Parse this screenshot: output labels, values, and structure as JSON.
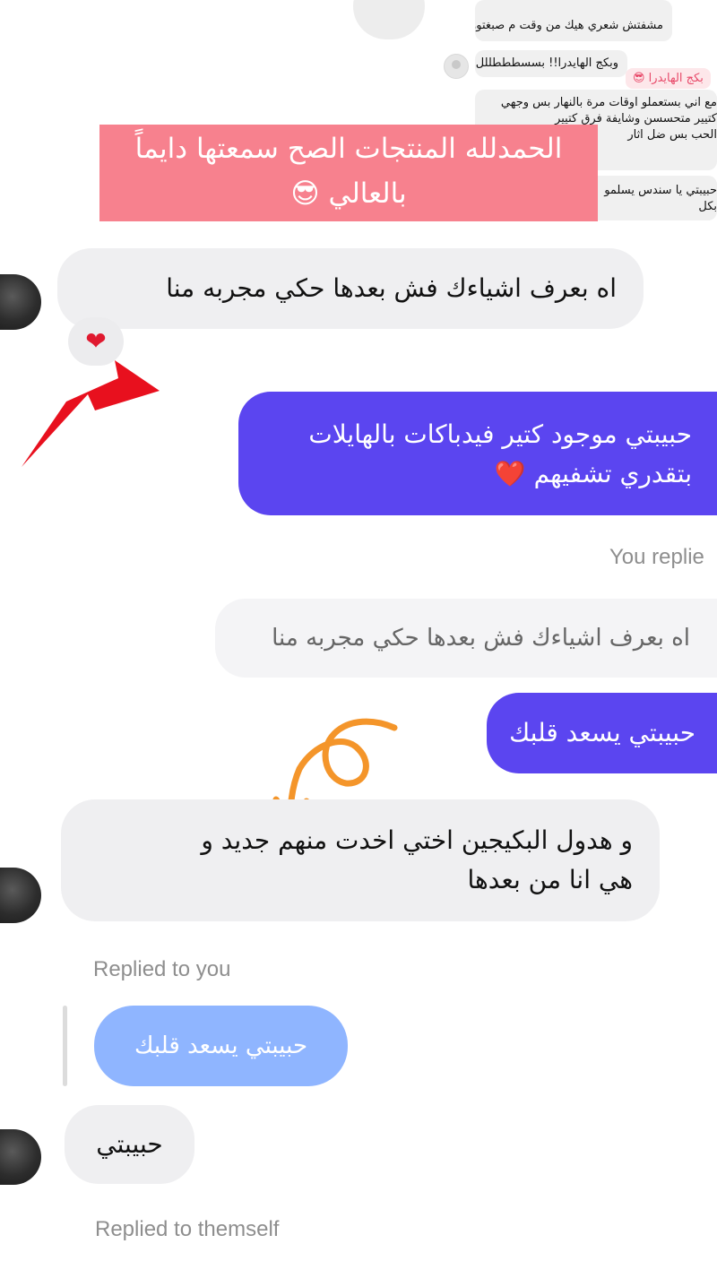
{
  "screenshot": {
    "line1": "مشفتش شعري هيك من وقت م صبغتوو",
    "line2": "وبكج الهايدرا!! بسسطططللل",
    "pink_label": "بكج الهايدرا 😎",
    "line3a": "مع اني بستعملو اوقات مرة بالنهار بس وجهي",
    "line3b": "كتيير متحسسن وشايفة فرق كتيير",
    "line3c": "الحب بس ضل اثار",
    "line4a": "حبيبتي يا سندس يسلمو",
    "line4b": "بكل"
  },
  "banner": {
    "line1": "الحمدلله المنتجات الصح سمعتها دايماً",
    "line2": "بالعالي 😎"
  },
  "messages": {
    "m1": "اه بعرف اشياءك فش بعدها حكي مجربه منا",
    "m1_reaction": "❤",
    "m2_line1": "حبيبتي موجود كتير فيدباكات بالهايلات",
    "m2_line2": "بتقدري تشفيهم",
    "m2_emoji": "❤️",
    "reply_meta_1": "You replie",
    "quote_1": "اه بعرف اشياءك فش بعدها حكي مجربه منا",
    "m3": "حبيبتي يسعد قلبك",
    "m4_line1": "و هدول البكيجين اختي اخدت منهم جديد و",
    "m4_line2": "هي انا من بعدها",
    "reply_meta_2": "Replied to you",
    "quote_2": "حبيبتي يسعد قلبك",
    "m5": "حبيبتي",
    "reply_meta_3": "Replied to themself"
  },
  "colors": {
    "outgoing": "#5b45f0",
    "incoming": "#efeff1",
    "banner": "#f7818e",
    "arrow_red": "#e8101e",
    "arrow_orange": "#f4952a"
  }
}
